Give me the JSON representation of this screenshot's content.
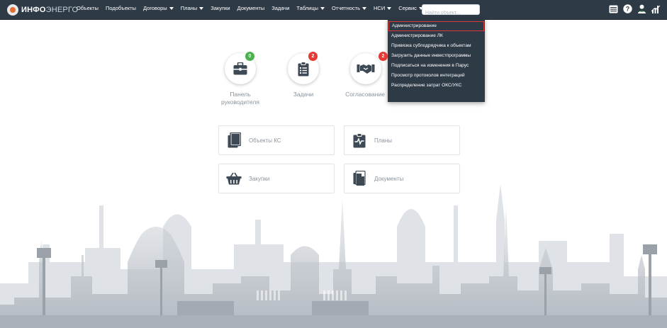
{
  "header": {
    "brand_bold": "ИНФО",
    "brand_light": "ЭНЕРГО",
    "nav": [
      {
        "label": "Объекты",
        "caret": false
      },
      {
        "label": "Подобъекты",
        "caret": false
      },
      {
        "label": "Договоры",
        "caret": true
      },
      {
        "label": "Планы",
        "caret": true
      },
      {
        "label": "Закупки",
        "caret": false
      },
      {
        "label": "Документы",
        "caret": false
      },
      {
        "label": "Задачи",
        "caret": false
      },
      {
        "label": "Таблицы",
        "caret": true
      },
      {
        "label": "Отчетность",
        "caret": true
      },
      {
        "label": "НСИ",
        "caret": true
      },
      {
        "label": "Сервис",
        "caret": true
      }
    ],
    "search_placeholder": "Найти объект...",
    "icons": [
      "table-icon",
      "help-icon",
      "user-icon",
      "chart-icon"
    ]
  },
  "service_menu": {
    "items": [
      "Администрирование",
      "Администрирование ЛК",
      "Привязка субподрядчика к объектам",
      "Загрузить данные инвестпрограммы",
      "Подписаться на изменения в Парус",
      "Просмотр протоколов интеграций",
      "Распределение затрат ОКС/УКС"
    ],
    "active_index": 0
  },
  "quick_tiles": [
    {
      "label": "Панель руководителя",
      "badge": "0",
      "badge_color": "#4caf50",
      "icon": "briefcase-icon"
    },
    {
      "label": "Задачи",
      "badge": "2",
      "badge_color": "#e53935",
      "icon": "clipboard-list-icon"
    },
    {
      "label": "Согласование",
      "badge": "2",
      "badge_color": "#e53935",
      "icon": "handshake-icon"
    }
  ],
  "cards": [
    {
      "label": "Объекты КС",
      "icon": "clipboard-icon"
    },
    {
      "label": "Планы",
      "icon": "pulse-clipboard-icon"
    },
    {
      "label": "Закупки",
      "icon": "basket-icon"
    },
    {
      "label": "Документы",
      "icon": "documents-icon"
    }
  ],
  "colors": {
    "topbar": "#2f3a47",
    "accent_red": "#e53935",
    "accent_green": "#4caf50",
    "icon_dark": "#3d4954",
    "skyline": "#b9bfc7"
  }
}
